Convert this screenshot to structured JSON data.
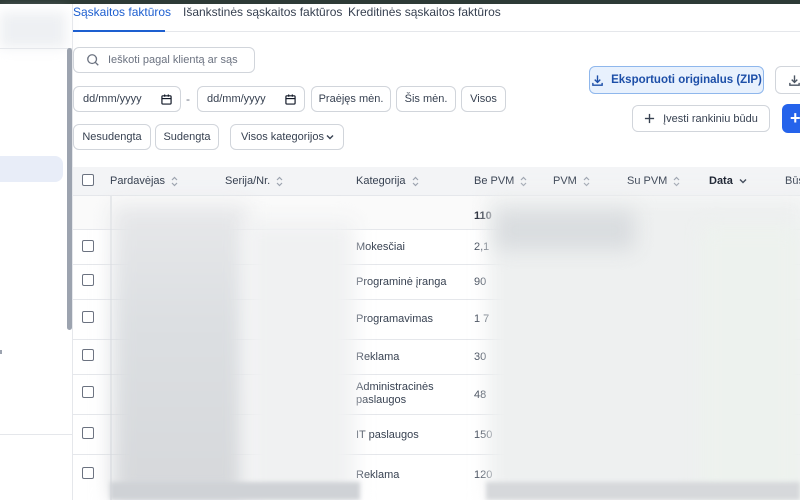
{
  "tabs": [
    {
      "label": "Sąskaitos faktūros",
      "active": true
    },
    {
      "label": "Išankstinės sąskaitos faktūros",
      "active": false
    },
    {
      "label": "Kreditinės sąskaitos faktūros",
      "active": false
    }
  ],
  "search": {
    "placeholder": "Ieškoti pagal klientą ar sąs"
  },
  "filters": {
    "date_from_placeholder": "dd/mm/yyyy",
    "date_separator": "-",
    "date_to_placeholder": "dd/mm/yyyy",
    "prev_month": "Praėjęs mėn.",
    "this_month": "Šis mėn.",
    "all": "Visos",
    "unpaid": "Nesudengta",
    "paid": "Sudengta",
    "category_select": "Visos kategorijos"
  },
  "actions": {
    "export_originals": "Eksportuoti originalus (ZIP)",
    "manual_entry": "Įvesti rankiniu būdu",
    "add": "+"
  },
  "table": {
    "columns": [
      "Pardavėjas",
      "Serija/Nr.",
      "Kategorija",
      "Be PVM",
      "PVM",
      "Su PVM",
      "Data",
      "Būs"
    ],
    "summary": {
      "be_pvm": "110"
    },
    "rows": [
      {
        "category": "Mokesčiai",
        "be_pvm": "2,1"
      },
      {
        "category": "Programinė įranga",
        "be_pvm": "90"
      },
      {
        "category": "Programavimas",
        "be_pvm": "1 7"
      },
      {
        "category": "Reklama",
        "be_pvm": "30"
      },
      {
        "category": "Administracinės paslaugos",
        "be_pvm": "48"
      },
      {
        "category": "IT paslaugos",
        "be_pvm": "150"
      },
      {
        "category": "Reklama",
        "be_pvm": "120"
      }
    ]
  },
  "colors": {
    "accent": "#1d5fd0",
    "primary_button": "#2563eb",
    "export_bg": "#e8f1fd"
  }
}
